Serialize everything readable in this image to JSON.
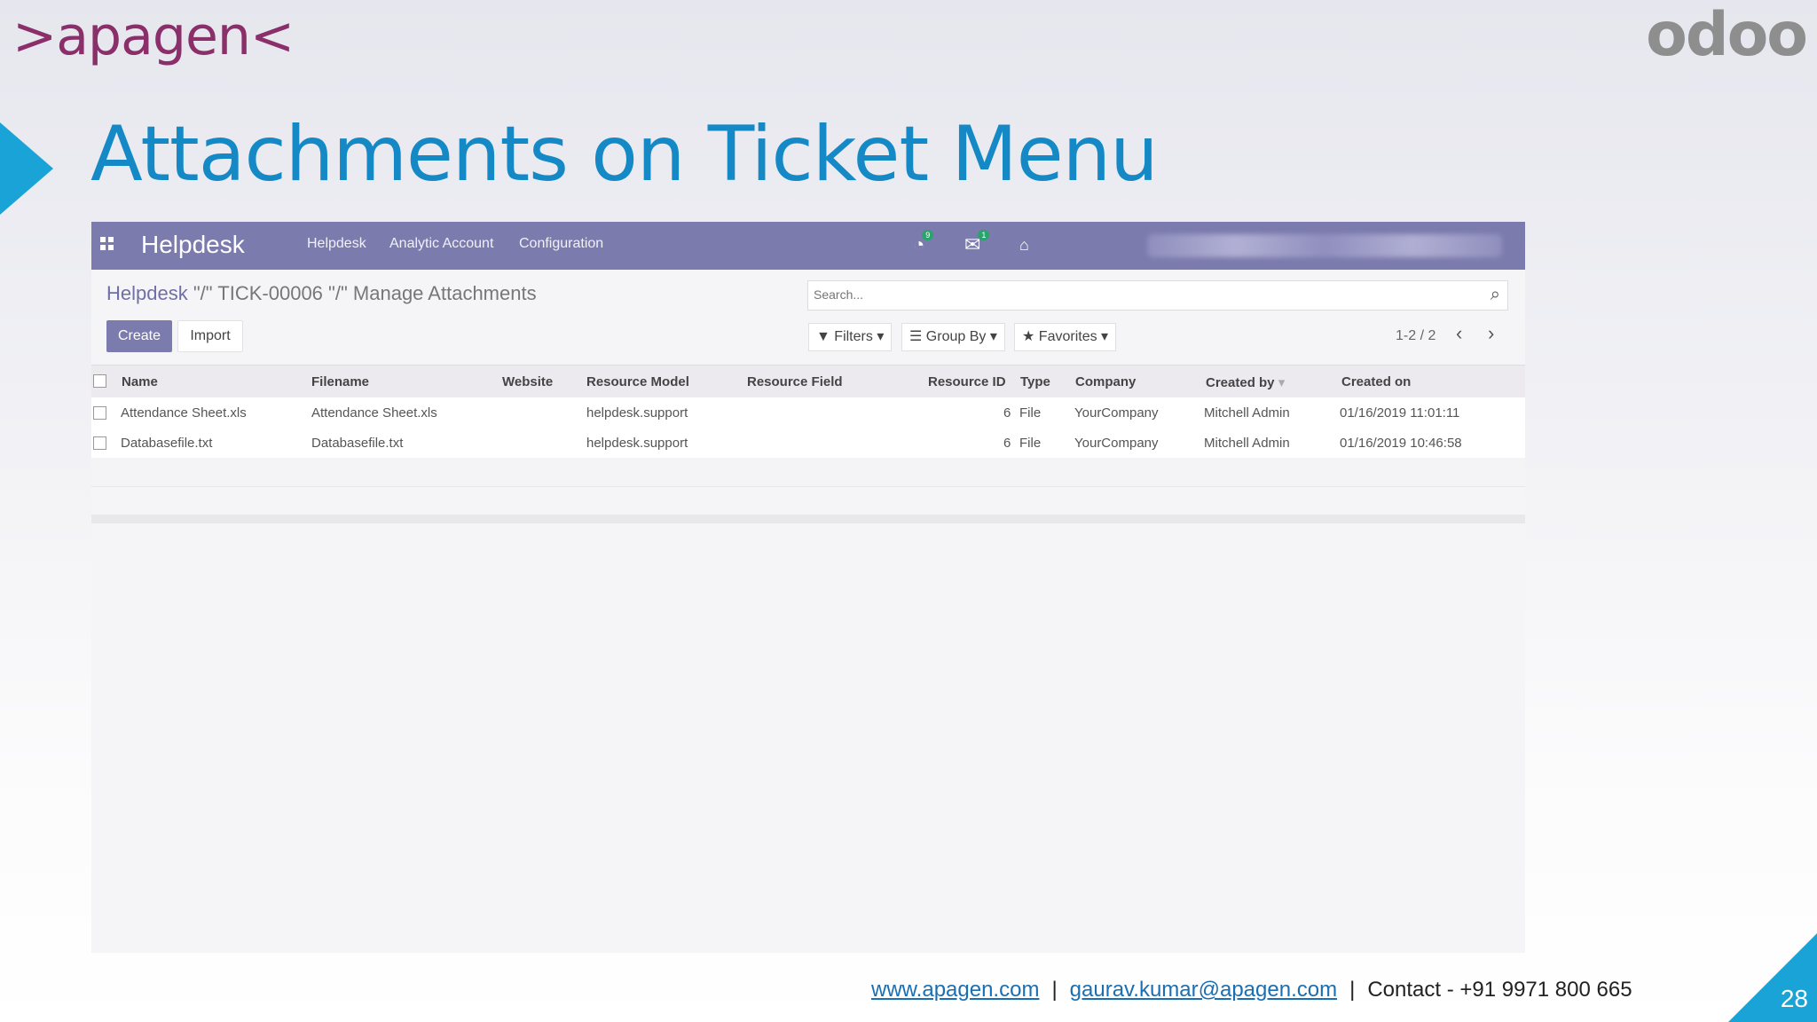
{
  "slide": {
    "logo_left": ">apagen<",
    "logo_right": "odoo",
    "title": "Attachments on Ticket Menu",
    "page_number": "28",
    "footer": {
      "website": "www.apagen.com",
      "email": "gaurav.kumar@apagen.com",
      "separator": "|",
      "contact": "Contact - +91 9971 800 665"
    },
    "colors": {
      "accent": "#1aa3d6",
      "odoo_purple": "#7c7bad",
      "title": "#1589c6"
    }
  },
  "app": {
    "name": "Helpdesk",
    "menu": [
      "Helpdesk",
      "Analytic Account",
      "Configuration"
    ],
    "icons": [
      "apps-icon",
      "activity-icon",
      "chat-icon",
      "home-icon"
    ],
    "activity_badge": "9",
    "chat_badge": "1"
  },
  "breadcrumb": {
    "root": "Helpdesk",
    "separator": "\"/\"",
    "middle": "TICK-00006",
    "current": "Manage Attachments"
  },
  "search": {
    "placeholder": "Search..."
  },
  "toolbar": {
    "create_label": "Create",
    "import_label": "Import",
    "filters_label": "Filters",
    "group_by_label": "Group By",
    "favorites_label": "Favorites",
    "pager": "1-2 / 2"
  },
  "table": {
    "headers": [
      "Name",
      "Filename",
      "Website",
      "Resource Model",
      "Resource Field",
      "Resource ID",
      "Type",
      "Company",
      "Created by",
      "Created on"
    ],
    "rows": [
      [
        "Attendance Sheet.xls",
        "Attendance Sheet.xls",
        "",
        "helpdesk.support",
        "",
        "6",
        "File",
        "YourCompany",
        "Mitchell Admin",
        "01/16/2019 11:01:11"
      ],
      [
        "Databasefile.txt",
        "Databasefile.txt",
        "",
        "helpdesk.support",
        "",
        "6",
        "File",
        "YourCompany",
        "Mitchell Admin",
        "01/16/2019 10:46:58"
      ]
    ]
  }
}
